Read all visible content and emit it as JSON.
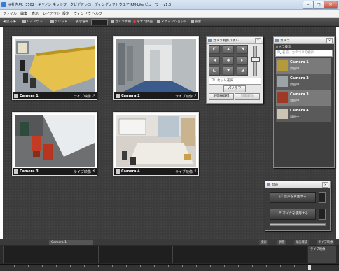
{
  "window": {
    "title": "※社内用：3502 - キヤノン ネットワークビデオレコーディングソフトウエア RM-Lite ビューワー v1.0"
  },
  "menu": [
    "ファイル",
    "編集",
    "表示",
    "レイアウト",
    "設定",
    "ウィンドウ",
    "ヘルプ"
  ],
  "toolbar": {
    "back_forward": "◀ 戻る ▶",
    "layout": "レイアウト",
    "grid": "グリッド",
    "display_magnification": "表示倍率",
    "zoom_value": "",
    "camera_info": "カメラ情報",
    "record_now": "今すぐ録画",
    "snapshot": "スナップショット",
    "search": "検索"
  },
  "cameras": [
    {
      "name": "Camera 1",
      "status": "ライブ映像"
    },
    {
      "name": "Camera 2",
      "status": "ライブ映像"
    },
    {
      "name": "Camera 3",
      "status": "ライブ映像"
    },
    {
      "name": "Camera 4",
      "status": "ライブ映像"
    }
  ],
  "ptz_panel": {
    "title": "カメラ制御パネル",
    "preset_placeholder": "プリセット選択",
    "panorama_label": "パノラマ",
    "request_control": "制御権取得",
    "release_control": "制御解放"
  },
  "camera_list_panel": {
    "title": "カメラ",
    "search_label": "カメラ検索",
    "search_placeholder": "名前、カテゴリで検索",
    "items": [
      {
        "name": "Camera 1",
        "status": "録画中"
      },
      {
        "name": "Camera 2",
        "status": "録画中"
      },
      {
        "name": "Camera 3",
        "status": "録画中"
      },
      {
        "name": "Camera 4",
        "status": "録画中"
      }
    ]
  },
  "audio_panel": {
    "title": "音声",
    "play_label": "音声を再生する",
    "mic_label": "マイクを使用する"
  },
  "timeline": {
    "tab_camera": "Camera 1",
    "right_tabs": [
      "検索",
      "状態",
      "録画確認",
      "ライブ映像"
    ],
    "live_label": "ライブ映像"
  },
  "colors": {
    "workspace_bg": "#3c3c3c",
    "toolbar_bg": "#4a4a4a",
    "panel_bg": "#e6e6e6",
    "record_red": "#d83b3b",
    "camlist_highlight": "#7a7a7a"
  }
}
